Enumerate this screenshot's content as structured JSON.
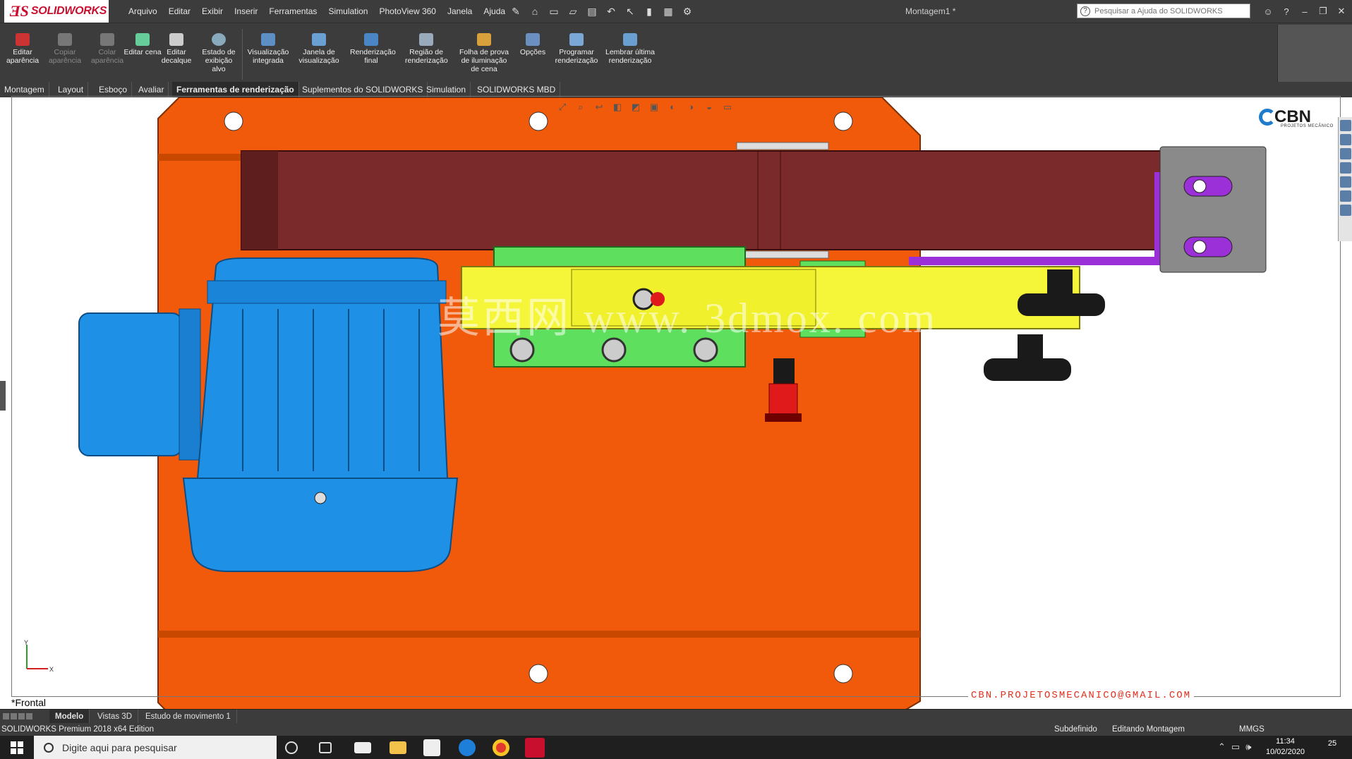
{
  "titlebar": {
    "brand": "SOLIDWORKS",
    "menu": [
      "Arquivo",
      "Editar",
      "Exibir",
      "Inserir",
      "Ferramentas",
      "Simulation",
      "PhotoView 360",
      "Janela",
      "Ajuda"
    ],
    "document_title": "Montagem1 *",
    "help_search_placeholder": "Pesquisar a Ajuda do SOLIDWORKS",
    "quick_access_icons": [
      "pin-icon",
      "home-icon",
      "new-file-icon",
      "open-folder-icon",
      "print-icon",
      "undo-icon",
      "select-arrow-icon",
      "traffic-light-icon",
      "options-gear-icon"
    ]
  },
  "ribbon": {
    "buttons": [
      {
        "label": "Editar aparência",
        "enabled": true
      },
      {
        "label": "Copiar aparência",
        "enabled": false
      },
      {
        "label": "Colar aparência",
        "enabled": false
      },
      {
        "label": "Editar cena",
        "enabled": true
      },
      {
        "label": "Editar decalque",
        "enabled": true
      },
      {
        "label": "Estado de exibição alvo",
        "enabled": true
      },
      {
        "label": "Visualização integrada",
        "enabled": true
      },
      {
        "label": "Janela de visualização",
        "enabled": true
      },
      {
        "label": "Renderização final",
        "enabled": true
      },
      {
        "label": "Região de renderização",
        "enabled": true
      },
      {
        "label": "Folha de prova de iluminação de cena",
        "enabled": true
      },
      {
        "label": "Opções",
        "enabled": true
      },
      {
        "label": "Programar renderização",
        "enabled": true
      },
      {
        "label": "Lembrar última renderização",
        "enabled": true
      }
    ]
  },
  "command_tabs": [
    {
      "label": "Montagem",
      "active": false
    },
    {
      "label": "Layout",
      "active": false
    },
    {
      "label": "Esboço",
      "active": false
    },
    {
      "label": "Avaliar",
      "active": false
    },
    {
      "label": "Ferramentas de renderização",
      "active": true
    },
    {
      "label": "Suplementos do SOLIDWORKS",
      "active": false
    },
    {
      "label": "Simulation",
      "active": false
    },
    {
      "label": "SOLIDWORKS MBD",
      "active": false
    }
  ],
  "viewport": {
    "view_name": "*Frontal",
    "brand_logo": "CBN",
    "brand_logo_sub": "PROJETOS MECÂNICO",
    "email": "CBN.PROJETOSMECANICO@GMAIL.COM",
    "watermark": "莫西网 www. 3dmox. com",
    "triad_x": "X",
    "triad_y": "Y",
    "colors": {
      "plate": "#f05a0a",
      "belt": "#7a2a2a",
      "motor": "#1e90e6",
      "bracket_green": "#5ee05e",
      "arm_yellow": "#f5f53a",
      "purple": "#9b30d8",
      "knob": "#1a1a1a",
      "red_knob": "#e01a1a"
    }
  },
  "bottom_tabs": [
    {
      "label": "Modelo",
      "active": true
    },
    {
      "label": "Vistas 3D",
      "active": false
    },
    {
      "label": "Estudo de movimento 1",
      "active": false
    }
  ],
  "statusbar": {
    "edition": "SOLIDWORKS Premium 2018 x64 Edition",
    "state": "Subdefinido",
    "mode": "Editando Montagem",
    "units": "MMGS"
  },
  "taskbar": {
    "search_placeholder": "Digite aqui para pesquisar",
    "time": "11:34",
    "date": "10/02/2020",
    "notifications": "25",
    "pinned": [
      "cortana-icon",
      "task-view-icon",
      "mail-icon",
      "file-explorer-icon",
      "store-icon",
      "edge-icon",
      "chrome-icon",
      "solidworks-2018-icon"
    ]
  }
}
